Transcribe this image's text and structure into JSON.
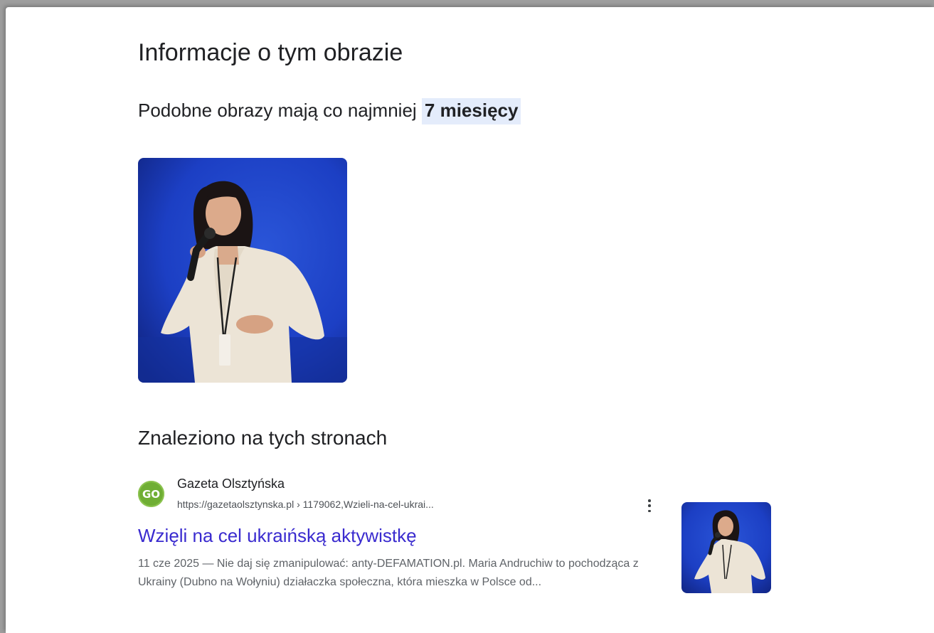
{
  "page": {
    "title": "Informacje o tym obrazie"
  },
  "age": {
    "prefix": "Podobne obrazy mają co najmniej ",
    "highlight": "7 miesięcy"
  },
  "found_on": {
    "heading": "Znaleziono na tych stronach"
  },
  "results": [
    {
      "favicon_text": "GO",
      "site_name": "Gazeta Olsztyńska",
      "url": "https://gazetaolsztynska.pl › 1179062,Wzieli-na-cel-ukrai...",
      "title": "Wzięli na cel ukraińską aktywistkę",
      "snippet": "11 cze 2025 — Nie daj się zmanipulować: anty-DEFAMATION.pl. Maria Andruchiw to pochodząca z Ukrainy (Dubno na Wołyniu) działaczka społeczna, która mieszka w Polsce od..."
    }
  ],
  "colors": {
    "link": "#3a2bcf",
    "highlight_bg": "#e4ecfb",
    "favicon_bg": "#6fae34",
    "photo_bg": "#1c3fc4"
  },
  "icons": {
    "more": "more-vert-icon"
  }
}
